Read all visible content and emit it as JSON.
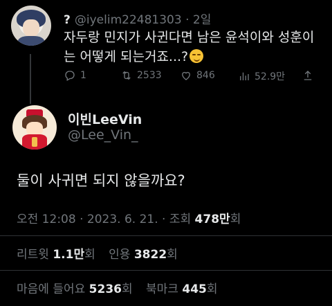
{
  "parent_tweet": {
    "display_name": "?",
    "handle": "@iyelim22481303",
    "separator": "·",
    "time": "2일",
    "text_line1": "자두랑 민지가 사귄다면 남은 윤석이와 성훈이",
    "text_line2": "는 어떻게 되는거죠...?",
    "emoji": "smirk-emoji",
    "actions": {
      "reply_count": "1",
      "retweet_count": "2533",
      "like_count": "846",
      "views_count": "52.9만"
    }
  },
  "main_tweet": {
    "display_name": "이빈LeeVin",
    "handle": "@Lee_Vin_",
    "text": "둘이 사귀면 되지 않을까요?",
    "time": "오전 12:08",
    "sep1": "·",
    "date": "2023. 6. 21.",
    "sep2": "·",
    "views_label": "조회",
    "views_number": "478만",
    "views_suffix": "회"
  },
  "stats": {
    "retweet_label": "리트윗",
    "retweet_number": "1.1만",
    "retweet_suffix": "회",
    "quote_label": "인용",
    "quote_number": "3822",
    "quote_suffix": "회",
    "like_label": "마음에 들어요",
    "like_number": "5236",
    "like_suffix": "회",
    "bookmark_label": "북마크",
    "bookmark_number": "445",
    "bookmark_suffix": "회"
  }
}
